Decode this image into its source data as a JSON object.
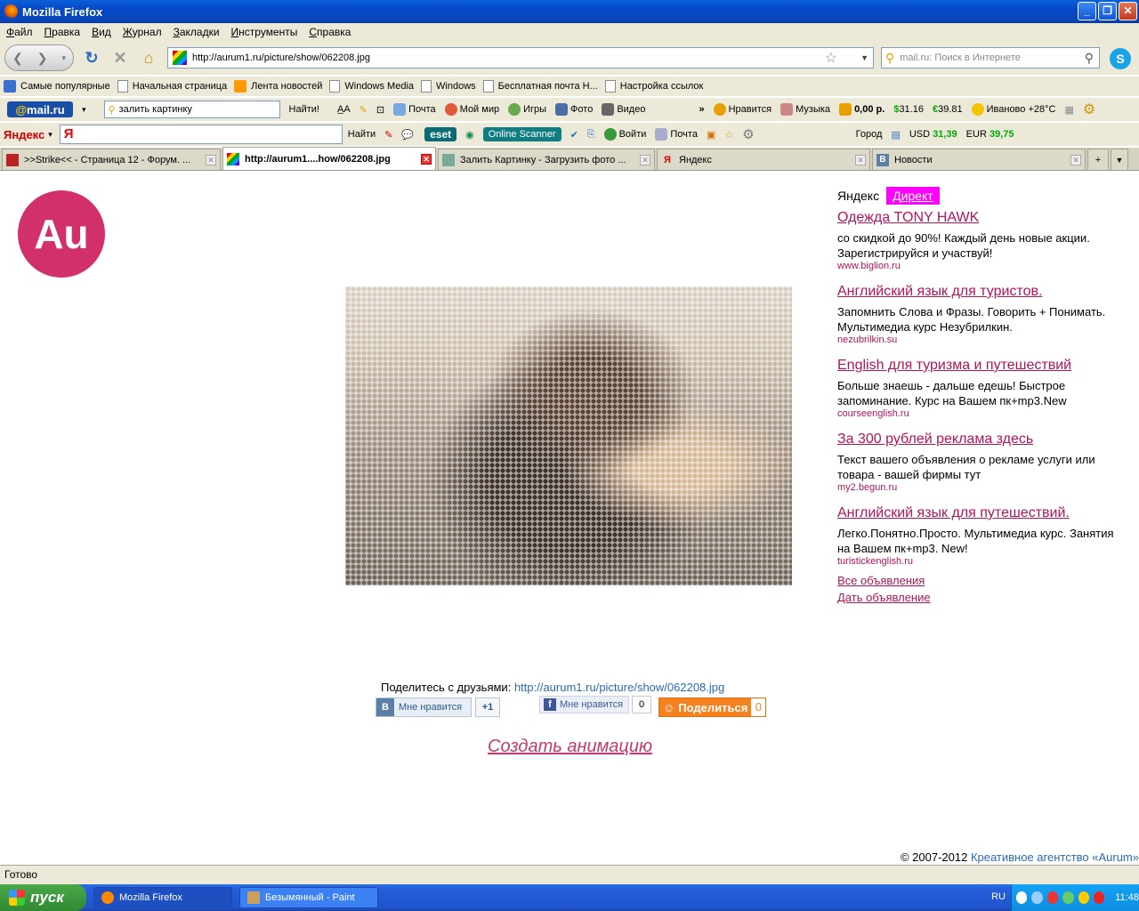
{
  "window": {
    "title": "Mozilla Firefox"
  },
  "menu": [
    "Файл",
    "Правка",
    "Вид",
    "Журнал",
    "Закладки",
    "Инструменты",
    "Справка"
  ],
  "nav": {
    "url": "http://aurum1.ru/picture/show/062208.jpg",
    "search_placeholder": "mail.ru: Поиск в Интернете"
  },
  "bookmarks": [
    {
      "label": "Самые популярные",
      "icon": "firefox-icon"
    },
    {
      "label": "Начальная страница",
      "icon": "page-icon"
    },
    {
      "label": "Лента новостей",
      "icon": "rss-icon"
    },
    {
      "label": "Windows Media",
      "icon": "page-icon"
    },
    {
      "label": "Windows",
      "icon": "page-icon"
    },
    {
      "label": "Бесплатная почта Н...",
      "icon": "page-icon"
    },
    {
      "label": "Настройка ссылок",
      "icon": "page-icon"
    }
  ],
  "mailbar": {
    "logo_at": "@",
    "logo": "mail.ru",
    "search_value": "залить картинку",
    "find_label": "Найти!",
    "items": [
      "Почта",
      "Мой мир",
      "Игры",
      "Фото",
      "Видео"
    ],
    "more": "»",
    "like": "Нравится",
    "music": "Музыка",
    "balance": "0,00 р.",
    "usd": "31.16",
    "eur": "39.81",
    "weather": "Иваново +28°C"
  },
  "yabar": {
    "logo": "Яндекс",
    "input_value": "Я",
    "find_label": "Найти",
    "eset": "eset",
    "scanner": "Online Scanner",
    "login": "Войти",
    "mail": "Почта",
    "city": "Город",
    "usd_label": "USD",
    "usd_value": "31,39",
    "eur_label": "EUR",
    "eur_value": "39,75"
  },
  "tabs": [
    {
      "label": ">>Strike<< - Страница 12 - Форум. ...",
      "active": false
    },
    {
      "label": "http://aurum1....how/062208.jpg",
      "active": true
    },
    {
      "label": "Залить Картинку - Загрузить фото ...",
      "active": false
    },
    {
      "label": "Яндекс",
      "active": false
    },
    {
      "label": "Новости",
      "active": false
    }
  ],
  "page": {
    "logo": "Au",
    "ads_header": {
      "yandex": "Яндекс",
      "direct": "Директ"
    },
    "ads": [
      {
        "title": "Одежда TONY HAWK",
        "text": "со скидкой до 90%! Каждый день новые акции. Зарегистрируйся и участвуй!",
        "url": "www.biglion.ru"
      },
      {
        "title": "Английский язык для туристов.",
        "text": "Запомнить Слова и Фразы. Говорить + Понимать. Мультимедиа курс Незубрилкин.",
        "url": "nezubrilkin.su"
      },
      {
        "title": "English для туризма и путешествий",
        "text": "Больше знаешь - дальше едешь! Быстрое запоминание. Курс на Вашем пк+mp3.New",
        "url": "courseenglish.ru"
      },
      {
        "title": "За 300 рублей реклама здесь",
        "text": "Текст вашего объявления о рекламе услуги или товара - вашей фирмы тут",
        "url": "my2.begun.ru"
      },
      {
        "title": "Английский язык для путешествий.",
        "text": "Легко.Понятно.Просто. Мультимедиа курс. Занятия на Вашем пк+mp3. New!",
        "url": "turistickenglish.ru"
      }
    ],
    "all_ads": "Все объявления",
    "give_ad": "Дать объявление",
    "share_text": "Поделитесь с друзьями:",
    "share_url": "http://aurum1.ru/picture/show/062208.jpg",
    "vk_label": "Мне нравится",
    "vk_count": "+1",
    "fb_label": "Мне нравится",
    "fb_count": "0",
    "ok_label": "Поделиться",
    "ok_count": "0",
    "create_anim": "Создать анимацию",
    "copyright": "© 2007-2012",
    "agency": "Креативное агентство «Aurum»"
  },
  "status": "Готово",
  "taskbar": {
    "start": "пуск",
    "tasks": [
      "Mozilla Firefox",
      "Безымянный - Paint"
    ],
    "lang": "RU",
    "time": "11:48"
  }
}
